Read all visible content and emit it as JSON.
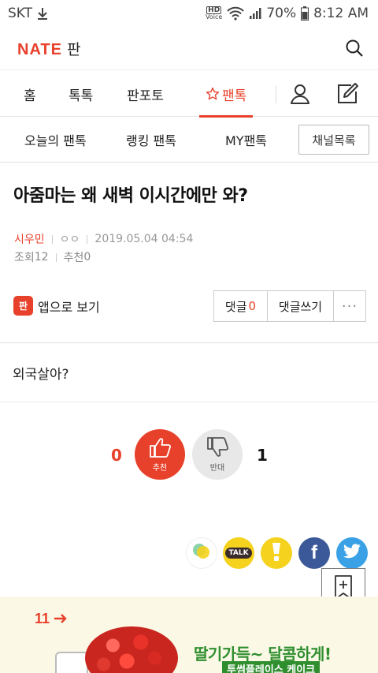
{
  "status_bar": {
    "carrier": "SKT",
    "hd_top": "HD",
    "hd_bottom": "Voice",
    "battery": "70%",
    "time": "8:12 AM"
  },
  "header": {
    "logo_brand": "NATE",
    "logo_service": "판"
  },
  "main_nav": {
    "tabs": [
      {
        "label": "홈",
        "active": false
      },
      {
        "label": "톡톡",
        "active": false
      },
      {
        "label": "판포토",
        "active": false
      },
      {
        "label": "팬톡",
        "active": true,
        "icon": "star-icon"
      }
    ]
  },
  "sub_nav": {
    "items": [
      "오늘의 팬톡",
      "랭킹 팬톡",
      "MY팬톡"
    ],
    "channel_button": "채널목록"
  },
  "post": {
    "title": "아줌마는 왜 새벽 이시간에만 와?",
    "author": "시우민",
    "author_extra": "ㅇㅇ",
    "datetime": "2019.05.04 04:54",
    "views_label": "조회",
    "views": "12",
    "recommend_label": "추천",
    "recommend": "0",
    "body": "외국살아?"
  },
  "actions": {
    "app_view_icon": "판",
    "app_view": "앱으로 보기",
    "comment_label": "댓글",
    "comment_count": "0",
    "write_comment": "댓글쓰기",
    "more": "···"
  },
  "vote": {
    "up_count": "0",
    "up_label": "추천",
    "down_label": "반대",
    "down_count": "1"
  },
  "share": {
    "kakaotalk_label": "TALK",
    "facebook_label": "f"
  },
  "ad": {
    "brand": "11",
    "headline": "딸기가득~ 달콤하게!",
    "sub": "투썸플레이스 케이크"
  },
  "colors": {
    "accent": "#e8412b",
    "facebook": "#3b5998",
    "twitter": "#3aa1e6",
    "kakao": "#f5d21d"
  }
}
